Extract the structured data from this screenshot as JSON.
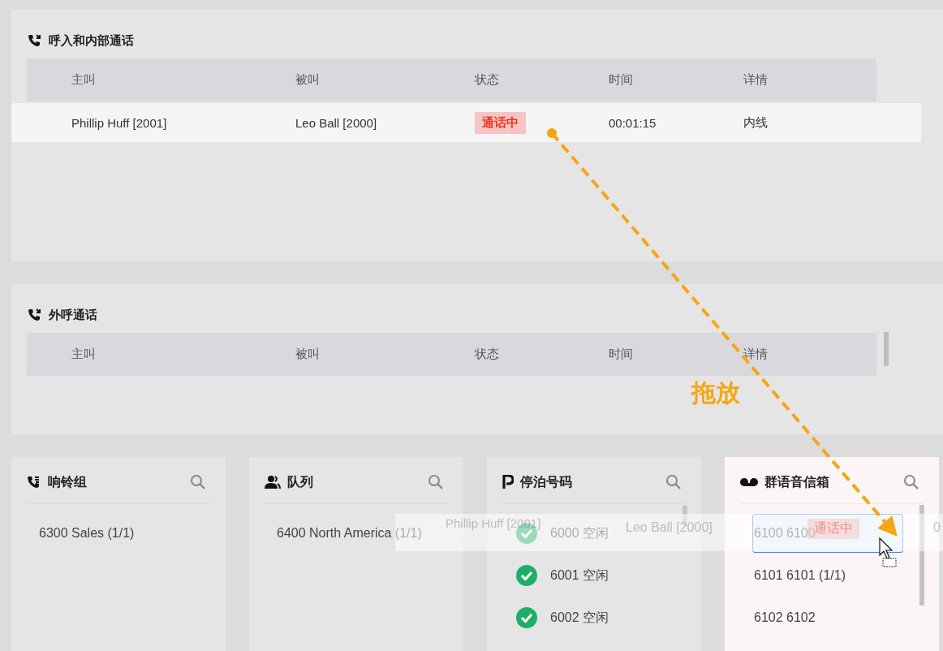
{
  "incoming": {
    "title": "呼入和内部通话",
    "columns": [
      "主叫",
      "被叫",
      "状态",
      "时间",
      "详情"
    ],
    "rows": [
      {
        "caller": "Phillip Huff [2001]",
        "callee": "Leo Ball [2000]",
        "status": "通话中",
        "time": "00:01:15",
        "details": "内线"
      }
    ]
  },
  "outgoing": {
    "title": "外呼通话",
    "columns": [
      "主叫",
      "被叫",
      "状态",
      "时间",
      "详情"
    ]
  },
  "cards": [
    {
      "kind": "ring_group",
      "title": "响铃组",
      "drop_target": false,
      "items": [
        {
          "label": "6300 Sales (1/1)"
        }
      ]
    },
    {
      "kind": "queue",
      "title": "队列",
      "drop_target": false,
      "items": [
        {
          "label": "6400 North America (1/1)"
        }
      ]
    },
    {
      "kind": "parking",
      "title": "停泊号码",
      "drop_target": false,
      "items": [
        {
          "label": "6000 空闲",
          "idle": true
        },
        {
          "label": "6001 空闲",
          "idle": true
        },
        {
          "label": "6002 空闲",
          "idle": true
        }
      ]
    },
    {
      "kind": "voicemail",
      "title": "群语音信箱",
      "drop_target": true,
      "items": [
        {
          "label": "6100 6100",
          "selected": true
        },
        {
          "label": "6101 6101 (1/1)",
          "selected": false
        },
        {
          "label": "6102 6102",
          "selected": false
        }
      ]
    }
  ],
  "drag": {
    "label": "拖放",
    "ghost_row": [
      "Phillip Huff [2001]",
      "Leo Ball [2000]",
      "通话中",
      "0"
    ]
  }
}
